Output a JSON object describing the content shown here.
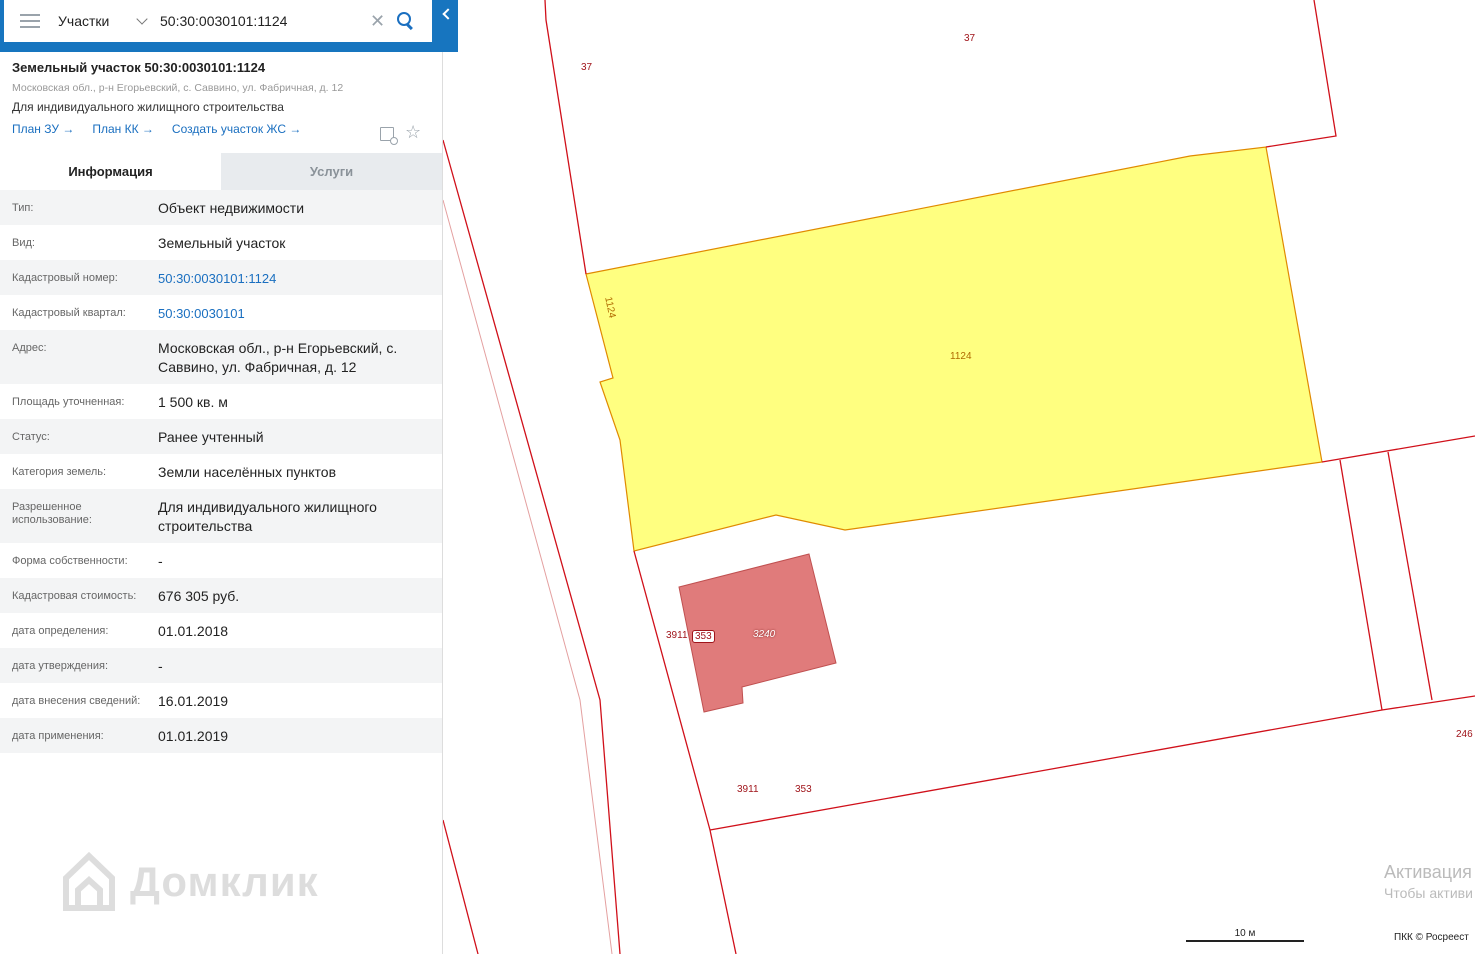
{
  "search": {
    "layer": "Участки",
    "query": "50:30:0030101:1124"
  },
  "card": {
    "title": "Земельный участок 50:30:0030101:1124",
    "address": "Московская обл., р-н Егорьевский, с. Саввино, ул. Фабричная, д. 12",
    "use": "Для индивидуального жилищного строительства",
    "links": [
      "План ЗУ →",
      "План КК →",
      "Создать участок ЖС →"
    ]
  },
  "tabs": [
    "Информация",
    "Услуги"
  ],
  "info": [
    {
      "label": "Тип:",
      "value": "Объект недвижимости"
    },
    {
      "label": "Вид:",
      "value": "Земельный участок"
    },
    {
      "label": "Кадастровый номер:",
      "value": "50:30:0030101:1124"
    },
    {
      "label": "Кадастровый квартал:",
      "value": "50:30:0030101"
    },
    {
      "label": "Адрес:",
      "value": "Московская обл., р-н Егорьевский, с. Саввино, ул. Фабричная, д. 12"
    },
    {
      "label": "Площадь уточненная:",
      "value": "1 500 кв. м"
    },
    {
      "label": "Статус:",
      "value": "Ранее учтенный"
    },
    {
      "label": "Категория земель:",
      "value": "Земли населённых пунктов"
    },
    {
      "label": "Разрешенное использование:",
      "value": "Для индивидуального жилищного строительства"
    },
    {
      "label": "Форма собственности:",
      "value": "-"
    },
    {
      "label": "Кадастровая стоимость:",
      "value": "676 305 руб."
    },
    {
      "label": "дата определения:",
      "value": "01.01.2018"
    },
    {
      "label": "дата утверждения:",
      "value": "-"
    },
    {
      "label": "дата внесения сведений:",
      "value": "16.01.2019"
    },
    {
      "label": "дата применения:",
      "value": "01.01.2019"
    }
  ],
  "map_labels": {
    "parcel_37_a": "37",
    "parcel_37_b": "37",
    "parcel_1124_side": "1124",
    "parcel_1124": "1124",
    "p3911_a": "3911",
    "p353_a": "353",
    "bldg_3240": "3240",
    "p3911_b": "3911",
    "p353_b": "353",
    "p246": "246"
  },
  "logo": "Домклик",
  "watermark": {
    "line1": "Активация",
    "line2": "Чтобы активи"
  },
  "scale": "10 м",
  "copyright": "ПКК © Росреест",
  "colors": {
    "selected_fill": "#ffff80",
    "selected_stroke": "#e08a00",
    "boundary": "#d0101a",
    "building": "#e07b7b",
    "topbar": "#1775bf",
    "link": "#1a6fc0"
  }
}
